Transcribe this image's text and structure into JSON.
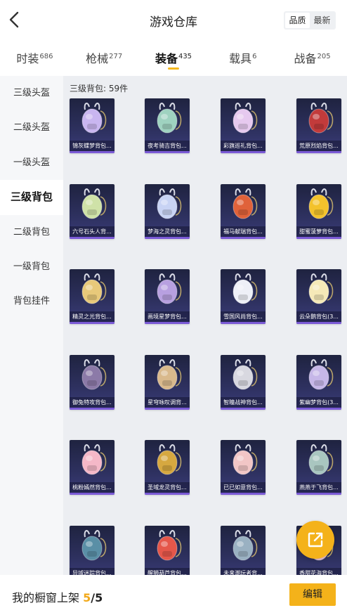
{
  "header": {
    "title": "游戏仓库",
    "sort_options": [
      "品质",
      "最新"
    ],
    "active_sort": 0
  },
  "tabs": [
    {
      "label": "时装",
      "count": "686"
    },
    {
      "label": "枪械",
      "count": "277"
    },
    {
      "label": "装备",
      "count": "435"
    },
    {
      "label": "载具",
      "count": "6"
    },
    {
      "label": "战备",
      "count": "205"
    }
  ],
  "active_tab": 2,
  "sidebar": {
    "items": [
      "三级头盔",
      "二级头盔",
      "一级头盔",
      "三级背包",
      "二级背包",
      "一级背包",
      "背包挂件"
    ],
    "active": 3
  },
  "section": {
    "title": "三级背包: 59件"
  },
  "items": [
    {
      "name": "锦灰蝶梦背包...",
      "color": "#c9b6f0"
    },
    {
      "name": "夜考骑吉背包...",
      "color": "#9fd2c0"
    },
    {
      "name": "彩旗巡礼背包...",
      "color": "#e6c9ef"
    },
    {
      "name": "荒原烈焰背包...",
      "color": "#c23b3b"
    },
    {
      "name": "六号石头人背...",
      "color": "#cfe2a8"
    },
    {
      "name": "梦海之灵背包...",
      "color": "#c8d3f4"
    },
    {
      "name": "福马献瑞背包...",
      "color": "#e0623a"
    },
    {
      "name": "甜蜜菠萝背包...",
      "color": "#f3c22c"
    },
    {
      "name": "精灵之光背包...",
      "color": "#e8c97a"
    },
    {
      "name": "画境星梦背包...",
      "color": "#b8a0e0"
    },
    {
      "name": "雪国风尚背包...",
      "color": "#eef0f7"
    },
    {
      "name": "云朵鹅背包(3...",
      "color": "#f5e9b8"
    },
    {
      "name": "御兔特攻背包...",
      "color": "#8c7aa8"
    },
    {
      "name": "星穹咏叹调背...",
      "color": "#d9b98c"
    },
    {
      "name": "智瞳战神背包...",
      "color": "#d8d8e0"
    },
    {
      "name": "紫幽梦背包(3...",
      "color": "#c6b7e8"
    },
    {
      "name": "桃粉嫣然背包...",
      "color": "#f5b8c8"
    },
    {
      "name": "圣域龙灵背包...",
      "color": "#d6a840"
    },
    {
      "name": "已已如意背包...",
      "color": "#f2c6c6"
    },
    {
      "name": "燕燕于飞背包...",
      "color": "#a9c6c0"
    },
    {
      "name": "异域迷踪背包...",
      "color": "#5a8fa6"
    },
    {
      "name": "醒狮葫芦背包...",
      "color": "#e5574a"
    },
    {
      "name": "未来潮玩者背...",
      "color": "#9ab1c2"
    },
    {
      "name": "香甜花海背包...",
      "color": "#f3c2d2"
    }
  ],
  "footer": {
    "prefix": "我的橱窗上架 ",
    "current": "5",
    "total": "/5",
    "edit_label": "编辑"
  },
  "colors": {
    "accent": "#f4b21a",
    "card_bg": "#2e3160",
    "card_bar": "#7b5ad6"
  }
}
